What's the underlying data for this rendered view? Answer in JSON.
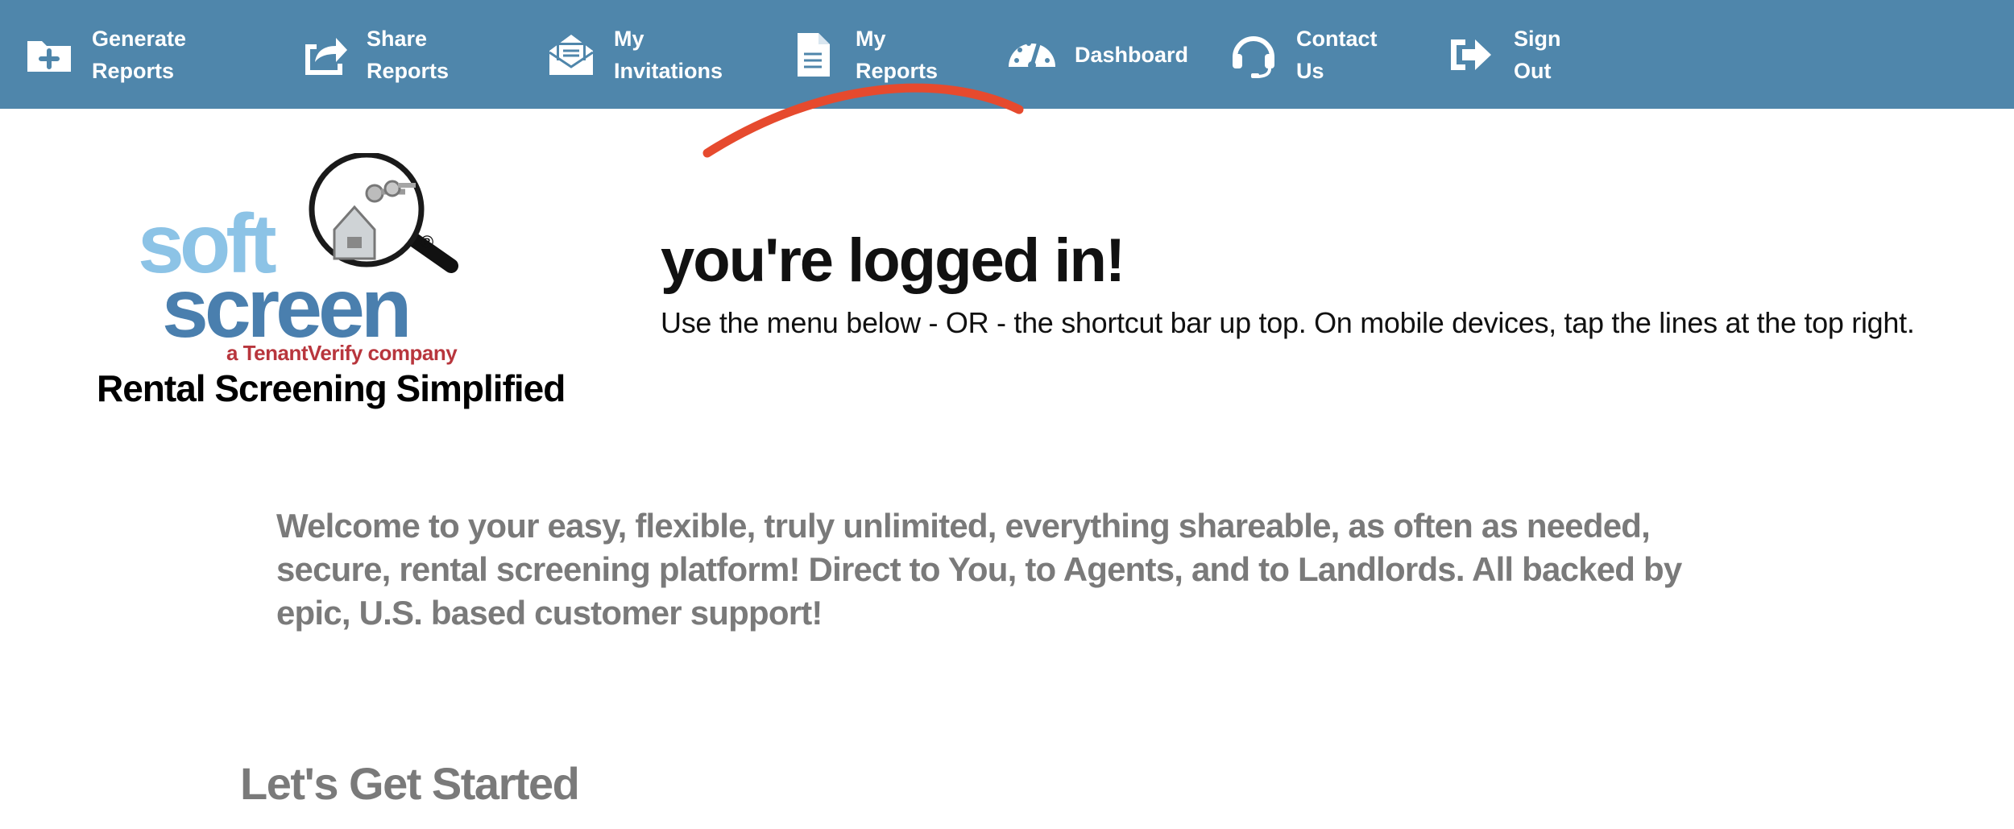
{
  "nav": {
    "items": [
      {
        "label": "Generate\nReports",
        "icon": "folder-plus-icon"
      },
      {
        "label": "Share\nReports",
        "icon": "share-icon"
      },
      {
        "label": "My\nInvitations",
        "icon": "envelope-open-icon"
      },
      {
        "label": "My\nReports",
        "icon": "document-icon"
      },
      {
        "label": "Dashboard",
        "icon": "dashboard-gauge-icon"
      },
      {
        "label": "Contact\nUs",
        "icon": "headset-icon"
      },
      {
        "label": "Sign\nOut",
        "icon": "sign-out-icon"
      }
    ]
  },
  "logo": {
    "word1": "soft",
    "word2": "screen",
    "registered": "®",
    "company": "a TenantVerify company",
    "tagline": "Rental Screening Simplified"
  },
  "main": {
    "heading": "you're logged in!",
    "subheading": "Use the menu below - OR - the shortcut bar up top. On mobile devices, tap the lines at the top right.",
    "welcome": "Welcome to your easy, flexible, truly unlimited, everything shareable, as often as needed, secure, rental screening platform! Direct to You, to Agents, and to Landlords. All backed by epic, U.S. based customer support!",
    "get_started": "Let's Get Started"
  },
  "colors": {
    "nav_bar": "#4f86ab",
    "logo_light_blue": "#8cc3e6",
    "logo_dark_blue": "#4a7fae",
    "logo_company_red": "#b8363d",
    "annotation_red": "#e64a2e",
    "welcome_text": "#7a7a7a"
  }
}
